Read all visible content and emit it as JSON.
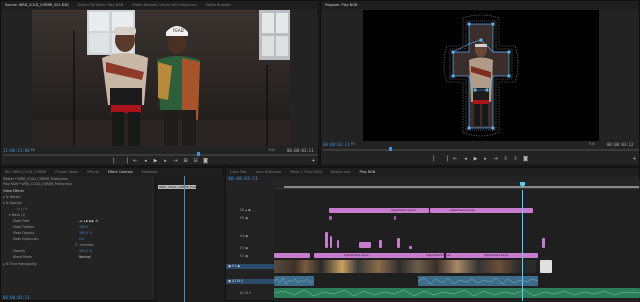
{
  "source_panel": {
    "tabs": [
      "Source: WRD_COLD_CORNR_001.R3D",
      "Audio Clip Mixer: Play NGN",
      "Media Browser: Vinnie NGN Sequence",
      "Media Browser"
    ],
    "timecode_left": "11:00:11:00",
    "timecode_right": "00:00:03:11",
    "zoom": "Fit",
    "res": "Full",
    "cap_text": "FEAD"
  },
  "program_panel": {
    "tabs": [
      "Program: Play NGN"
    ],
    "timecode_left": "00:00:03:11",
    "timecode_right": "00:00:03:12",
    "zoom": "Fit",
    "res": "Full"
  },
  "effect_controls": {
    "tabs": [
      "Bin: WRD_COLD_CORNR",
      "Project: ideas",
      "Effects",
      "Effect Controls",
      "Metadata"
    ],
    "source_line": "Master * WRD_COLD_CORNR_Frakty.mov",
    "clip_line": "Play NGN * WRD_COLD_CORNR_Frakty.mov",
    "clip_badge": "WRD_COLD_CORNR_Frakty.mov",
    "sections": {
      "video_effects": "Video Effects",
      "motion": "Motion",
      "opacity": "Opacity",
      "time_remap": "Time Remapping"
    },
    "mask_label": "Mask (1)",
    "params": [
      {
        "label": "Mask Path",
        "value": ""
      },
      {
        "label": "Mask Feather",
        "value": "105.0"
      },
      {
        "label": "Mask Opacity",
        "value": "100.0 %"
      },
      {
        "label": "Mask Expansion",
        "value": "0.0"
      },
      {
        "label": "",
        "value": "Inverted"
      },
      {
        "label": "Opacity",
        "value": "100.0 %"
      },
      {
        "label": "Blend Mode",
        "value": "Normal"
      }
    ],
    "timecode": "00:00:03:11"
  },
  "timeline": {
    "tabs": [
      "Color Test",
      "Lens Distortion",
      "Mask + Track NGN",
      "Nested rule",
      "Play NGN"
    ],
    "timecode": "00:00:03:11",
    "tracks": [
      "V6",
      "V5",
      "V4",
      "V3",
      "V2",
      "V1",
      "A1",
      "A2"
    ],
    "clip_labels": {
      "v6a": "Adjustment Layer",
      "v6b": "Adjustment Layer",
      "v1a": "Adjustment Layer",
      "v1b": "Adjustment Layer",
      "v1c": "Adjustment Layer"
    }
  },
  "colors": {
    "accent": "#3d8fd6",
    "clip_pink": "#c87ccd",
    "clip_pink_dark": "#a65fb0",
    "audio_green": "#2e7d5a",
    "audio_blue": "#3e6d8a",
    "playhead": "#4fd1f0"
  }
}
